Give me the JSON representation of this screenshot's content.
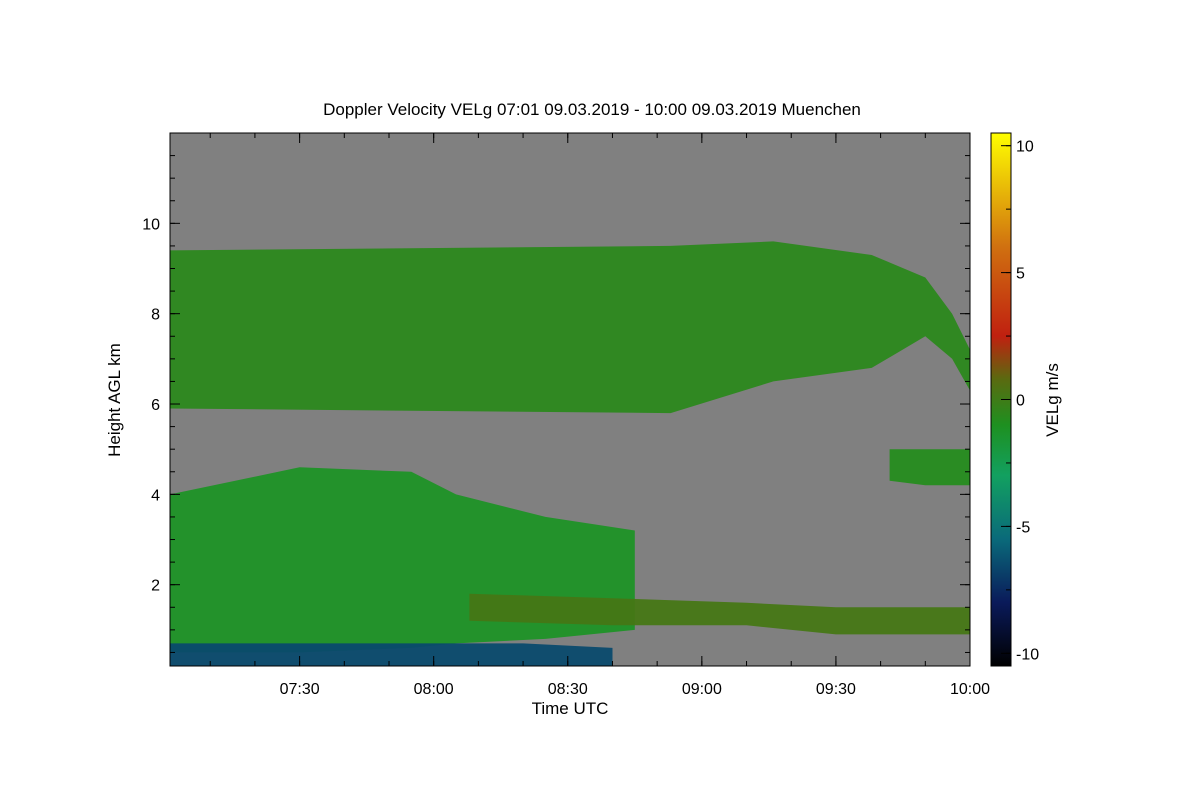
{
  "chart_data": {
    "type": "heatmap",
    "title": "Doppler Velocity VELg   07:01 09.03.2019 - 10:00 09.03.2019 Muenchen",
    "xlabel": "Time UTC",
    "ylabel": "Height AGL km",
    "colorbar_label": "VELg m/s",
    "xlim": [
      421,
      600
    ],
    "ylim": [
      0.2,
      12.0
    ],
    "zlim": [
      -10.5,
      10.5
    ],
    "x_ticks": [
      {
        "value": 450,
        "label": "07:30"
      },
      {
        "value": 480,
        "label": "08:00"
      },
      {
        "value": 510,
        "label": "08:30"
      },
      {
        "value": 540,
        "label": "09:00"
      },
      {
        "value": 570,
        "label": "09:30"
      },
      {
        "value": 600,
        "label": "10:00"
      }
    ],
    "y_ticks": [
      {
        "value": 2,
        "label": "2"
      },
      {
        "value": 4,
        "label": "4"
      },
      {
        "value": 6,
        "label": "6"
      },
      {
        "value": 8,
        "label": "8"
      },
      {
        "value": 10,
        "label": "10"
      }
    ],
    "colorbar_ticks": [
      {
        "value": 10,
        "label": "10"
      },
      {
        "value": 5,
        "label": "5"
      },
      {
        "value": 0,
        "label": "0"
      },
      {
        "value": -5,
        "label": "-5"
      },
      {
        "value": -10,
        "label": "-10"
      }
    ],
    "colormap": [
      {
        "v": -10.5,
        "c": "#000000"
      },
      {
        "v": -8,
        "c": "#0a1a5a"
      },
      {
        "v": -5.5,
        "c": "#0a6a7a"
      },
      {
        "v": -3,
        "c": "#12a060"
      },
      {
        "v": -1,
        "c": "#1e9020"
      },
      {
        "v": 0.8,
        "c": "#5a6a10"
      },
      {
        "v": 2.5,
        "c": "#c02010"
      },
      {
        "v": 6,
        "c": "#d07010"
      },
      {
        "v": 10.5,
        "c": "#ffff00"
      }
    ],
    "background_color": "#808080",
    "regions": [
      {
        "name": "upper cloud layer",
        "x": [
          421,
          533,
          556,
          578,
          590,
          596,
          600
        ],
        "top": [
          9.4,
          9.5,
          9.6,
          9.3,
          8.8,
          8.0,
          7.2
        ],
        "bottom": [
          5.9,
          5.8,
          6.5,
          6.8,
          7.5,
          7.0,
          6.3
        ],
        "velocity": -0.6
      },
      {
        "name": "middle layer",
        "x": [
          421,
          450,
          475,
          485,
          505,
          525
        ],
        "top": [
          4.0,
          4.6,
          4.5,
          4.0,
          3.5,
          3.2
        ],
        "bottom": [
          0.5,
          0.5,
          0.6,
          0.7,
          0.8,
          1.0
        ],
        "velocity": -1.2
      },
      {
        "name": "right layer",
        "x": [
          582,
          590,
          600
        ],
        "top": [
          5.0,
          5.0,
          5.0
        ],
        "bottom": [
          4.3,
          4.2,
          4.2
        ],
        "velocity": -0.8
      },
      {
        "name": "low layer",
        "x": [
          488,
          520,
          550,
          570,
          600
        ],
        "top": [
          1.8,
          1.7,
          1.6,
          1.5,
          1.5
        ],
        "bottom": [
          1.2,
          1.1,
          1.1,
          0.9,
          0.9
        ],
        "velocity": 0.2
      },
      {
        "name": "near surface",
        "x": [
          421,
          450,
          480,
          500,
          520
        ],
        "top": [
          0.7,
          0.7,
          0.7,
          0.7,
          0.6
        ],
        "bottom": [
          0.2,
          0.2,
          0.2,
          0.2,
          0.2
        ],
        "velocity": -6.5
      }
    ]
  }
}
